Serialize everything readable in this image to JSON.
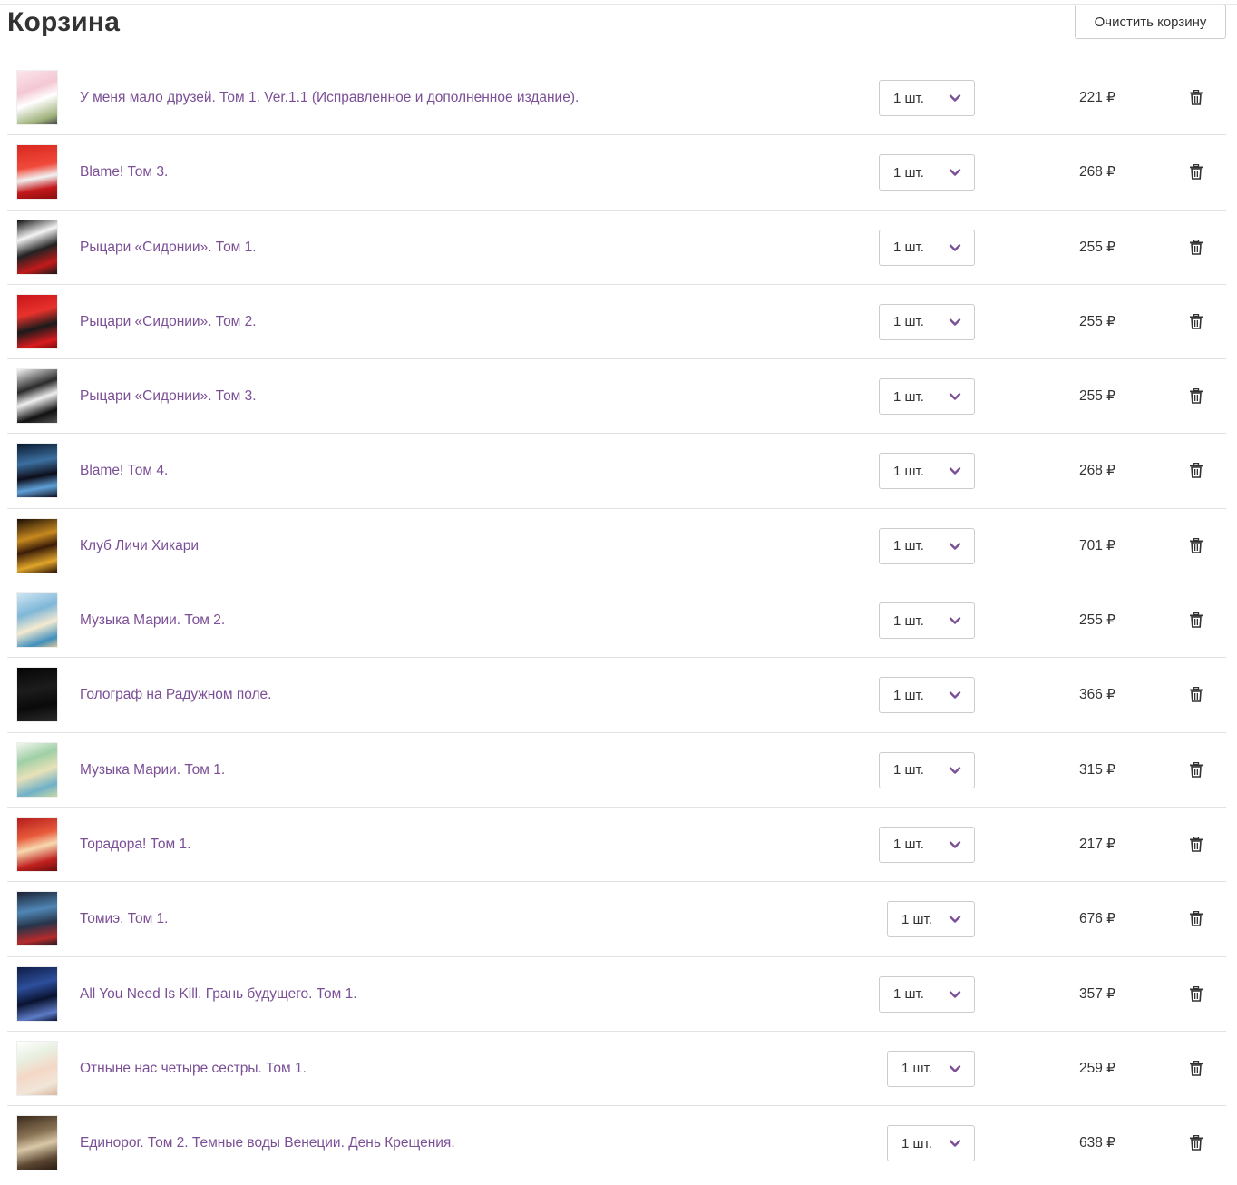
{
  "page": {
    "title": "Корзина",
    "clear_button": "Очистить корзину"
  },
  "icons": {
    "quantity_chevron": "chevron-down-icon",
    "remove_item": "trash-icon"
  },
  "colors": {
    "link": "#7b4f96",
    "text": "#333333",
    "border": "#cccccc",
    "divider": "#e3e3e3"
  },
  "cart": {
    "items": [
      {
        "title": "У меня мало друзей. Том 1. Ver.1.1 (Исправленное и дополненное издание).",
        "quantity": "1 шт.",
        "price": "221 ₽"
      },
      {
        "title": "Blame! Том 3.",
        "quantity": "1 шт.",
        "price": "268 ₽"
      },
      {
        "title": "Рыцари «Сидонии». Том 1.",
        "quantity": "1 шт.",
        "price": "255 ₽"
      },
      {
        "title": "Рыцари «Сидонии». Том 2.",
        "quantity": "1 шт.",
        "price": "255 ₽"
      },
      {
        "title": "Рыцари «Сидонии». Том 3.",
        "quantity": "1 шт.",
        "price": "255 ₽"
      },
      {
        "title": "Blame! Том 4.",
        "quantity": "1 шт.",
        "price": "268 ₽"
      },
      {
        "title": "Клуб Личи Хикари",
        "quantity": "1 шт.",
        "price": "701 ₽"
      },
      {
        "title": "Музыка Марии. Том 2.",
        "quantity": "1 шт.",
        "price": "255 ₽"
      },
      {
        "title": "Голограф на Радужном поле.",
        "quantity": "1 шт.",
        "price": "366 ₽"
      },
      {
        "title": "Музыка Марии. Том 1.",
        "quantity": "1 шт.",
        "price": "315 ₽"
      },
      {
        "title": "Торадора! Том 1.",
        "quantity": "1 шт.",
        "price": "217 ₽"
      },
      {
        "title": "Томиэ. Том 1.",
        "quantity": "1 шт.",
        "price": "676 ₽"
      },
      {
        "title": "All You Need Is Kill. Грань будущего. Том 1.",
        "quantity": "1 шт.",
        "price": "357 ₽"
      },
      {
        "title": "Отныне нас четыре сестры. Том 1.",
        "quantity": "1 шт.",
        "price": "259 ₽"
      },
      {
        "title": "Единорог. Том 2. Темные воды Венеции. День Крещения.",
        "quantity": "1 шт.",
        "price": "638 ₽"
      }
    ]
  }
}
